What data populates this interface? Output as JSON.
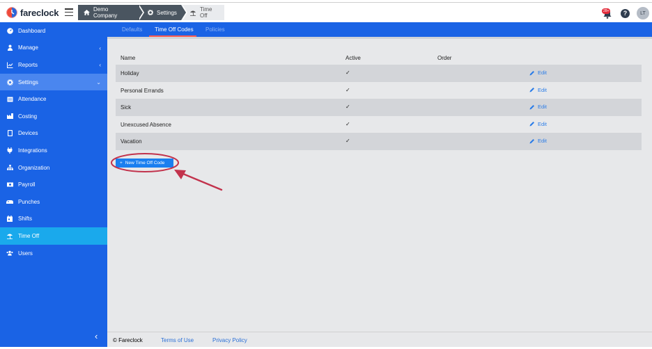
{
  "brand": {
    "name": "fareclock"
  },
  "breadcrumb": [
    {
      "label": "Demo Company",
      "icon": "home-icon"
    },
    {
      "label": "Settings",
      "icon": "gear-icon"
    },
    {
      "label": "Time Off",
      "icon": "beach-umbrella-icon"
    }
  ],
  "header": {
    "notification_badge": "28+",
    "help": "?",
    "avatar_initials": "LT"
  },
  "sidebar": {
    "items": [
      {
        "label": "Dashboard",
        "icon": "dashboard-icon"
      },
      {
        "label": "Manage",
        "icon": "person-icon",
        "chevron": "‹"
      },
      {
        "label": "Reports",
        "icon": "chart-icon",
        "chevron": "‹"
      },
      {
        "label": "Settings",
        "icon": "gear-icon",
        "chevron": "⌄"
      },
      {
        "label": "Attendance",
        "icon": "attendance-icon"
      },
      {
        "label": "Costing",
        "icon": "factory-icon"
      },
      {
        "label": "Devices",
        "icon": "tablet-icon"
      },
      {
        "label": "Integrations",
        "icon": "plug-icon"
      },
      {
        "label": "Organization",
        "icon": "sitemap-icon"
      },
      {
        "label": "Payroll",
        "icon": "money-icon"
      },
      {
        "label": "Punches",
        "icon": "punch-icon"
      },
      {
        "label": "Shifts",
        "icon": "calendar-icon"
      },
      {
        "label": "Time Off",
        "icon": "beach-umbrella-icon"
      },
      {
        "label": "Users",
        "icon": "users-icon"
      }
    ],
    "collapse_glyph": "‹"
  },
  "tabs": [
    {
      "label": "Defaults"
    },
    {
      "label": "Time Off Codes",
      "active": true
    },
    {
      "label": "Policies"
    }
  ],
  "table": {
    "headers": {
      "name": "Name",
      "active": "Active",
      "order": "Order"
    },
    "rows": [
      {
        "name": "Holiday",
        "active": "✓",
        "edit": "Edit"
      },
      {
        "name": "Personal Errands",
        "active": "✓",
        "edit": "Edit"
      },
      {
        "name": "Sick",
        "active": "✓",
        "edit": "Edit"
      },
      {
        "name": "Unexcused Absence",
        "active": "✓",
        "edit": "Edit"
      },
      {
        "name": "Vacation",
        "active": "✓",
        "edit": "Edit"
      }
    ]
  },
  "new_button": {
    "label": "New Time Off Code",
    "icon": "plus-icon"
  },
  "footer": {
    "copyright": "© Fareclock",
    "terms": "Terms of Use",
    "privacy": "Privacy Policy"
  },
  "colors": {
    "sidebar": "#1a63e5",
    "active_item": "#1aa9ec",
    "accent_button": "#1a7ff0",
    "annotation": "#c2324c"
  }
}
